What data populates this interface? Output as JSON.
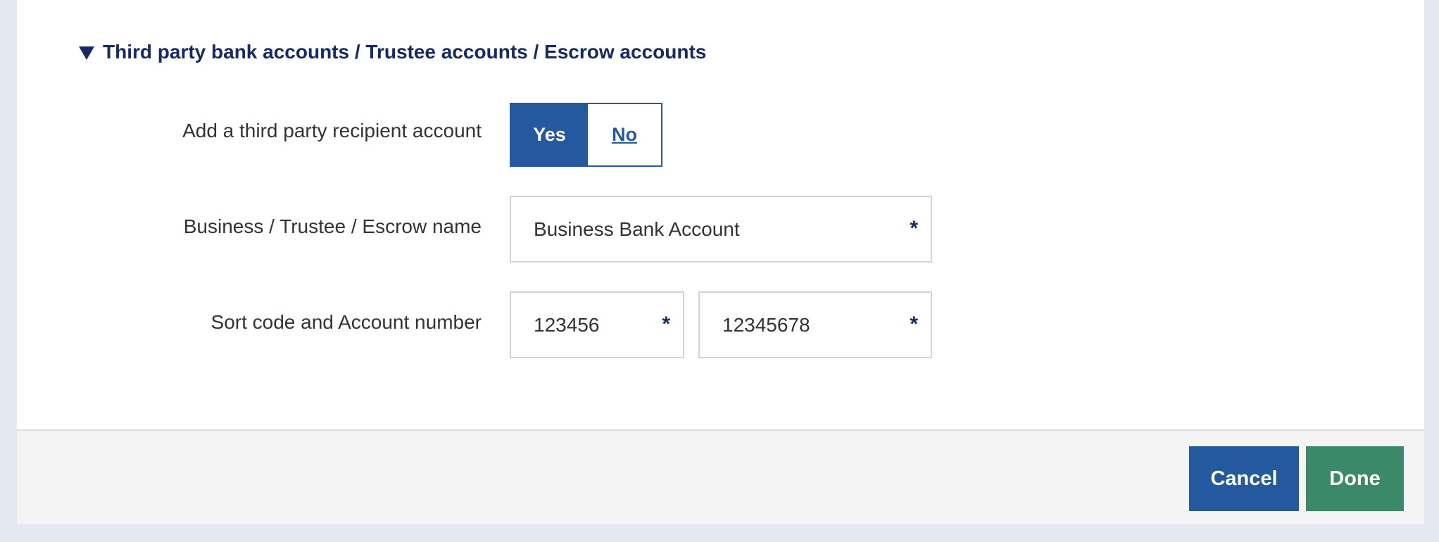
{
  "section": {
    "title": "Third party bank accounts / Trustee accounts / Escrow accounts",
    "expanded": true
  },
  "third_party": {
    "label": "Add a third party recipient account",
    "yes_label": "Yes",
    "no_label": "No",
    "selected": "Yes"
  },
  "business_name": {
    "label": "Business / Trustee / Escrow name",
    "value": "Business Bank Account",
    "required_marker": "*"
  },
  "account": {
    "label": "Sort code and Account number",
    "sort_code": "123456",
    "account_number": "12345678",
    "required_marker": "*"
  },
  "footer": {
    "cancel_label": "Cancel",
    "done_label": "Done"
  },
  "colors": {
    "primary": "#2459a0",
    "success": "#3a8a69",
    "heading": "#152a66"
  }
}
